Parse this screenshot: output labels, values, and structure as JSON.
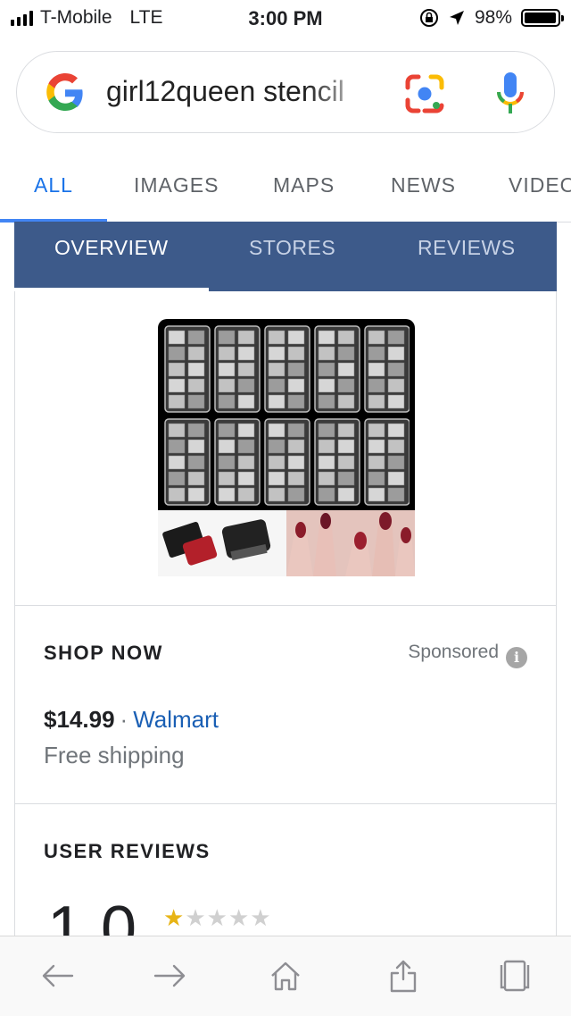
{
  "status_bar": {
    "carrier": "T-Mobile",
    "network": "LTE",
    "time": "3:00 PM",
    "battery_text": "98%",
    "battery_level": 0.98,
    "icons": [
      "signal-bars-icon",
      "rotation-lock-icon",
      "location-arrow-icon",
      "battery-icon"
    ]
  },
  "search": {
    "query": "girl12queen stencil",
    "icons": [
      "google-g-icon",
      "google-lens-icon",
      "microphone-icon"
    ]
  },
  "tabs": [
    {
      "label": "ALL",
      "active": true
    },
    {
      "label": "IMAGES",
      "active": false
    },
    {
      "label": "MAPS",
      "active": false
    },
    {
      "label": "NEWS",
      "active": false
    },
    {
      "label": "VIDEO",
      "active": false
    }
  ],
  "subtabs": [
    {
      "label": "OVERVIEW",
      "active": true
    },
    {
      "label": "STORES",
      "active": false
    },
    {
      "label": "REVIEWS",
      "active": false
    }
  ],
  "shop": {
    "title": "SHOP NOW",
    "sponsored": "Sponsored",
    "info_icon": "i",
    "price": "$14.99",
    "separator": "·",
    "store": "Walmart",
    "shipping": "Free shipping"
  },
  "reviews": {
    "title": "USER REVIEWS",
    "rating": "1.0",
    "stars_filled": 1,
    "stars_total": 5
  },
  "toolbar": {
    "icons": [
      "back-arrow-icon",
      "forward-arrow-icon",
      "home-icon",
      "share-icon",
      "tabs-icon"
    ]
  },
  "colors": {
    "accent_blue": "#1a73e8",
    "subtab_bar": "#3d5a8a",
    "link_blue": "#1a5fb4",
    "star_gold": "#e7b416"
  }
}
